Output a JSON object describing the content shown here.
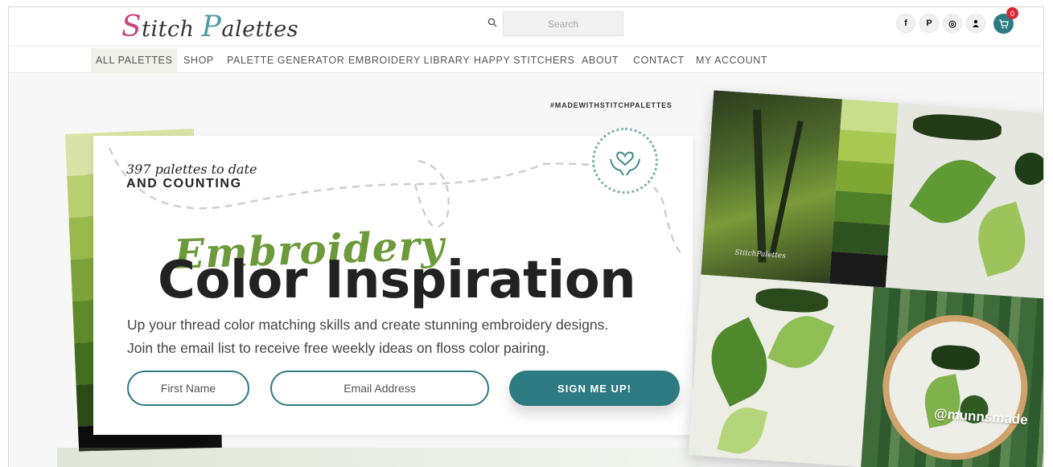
{
  "header": {
    "logo": {
      "cap1": "S",
      "rest1": "titch ",
      "cap2": "P",
      "rest2": "alettes"
    },
    "search": {
      "placeholder": "Search"
    },
    "social_icons": [
      "facebook-icon",
      "pinterest-icon",
      "instagram-icon",
      "account-icon"
    ],
    "social_glyphs": {
      "facebook": "f",
      "pinterest": "P",
      "instagram": "◎",
      "account": "●"
    },
    "cart": {
      "count": "0"
    }
  },
  "nav": {
    "items": [
      "ALL PALETTES",
      "SHOP",
      "PALETTE GENERATOR",
      "EMBROIDERY LIBRARY",
      "HAPPY STITCHERS",
      "ABOUT",
      "CONTACT",
      "MY ACCOUNT"
    ]
  },
  "hero": {
    "hashtag": "#MADEWITHSTITCHPALETTES",
    "tagline_script": "397 palettes to date",
    "tagline_caps": "AND COUNTING",
    "script_title": "Embroidery",
    "main_title": "Color Inspiration",
    "subtitle_line1": "Up your thread color matching skills and create stunning embroidery designs.",
    "subtitle_line2": "Join the email list to receive free weekly ideas on floss color pairing.",
    "first_name_placeholder": "First Name",
    "email_placeholder": "Email Address",
    "signup_label": "SIGN ME UP!",
    "swatch_colors": [
      "#d9e3a6",
      "#b7cf6f",
      "#98b94c",
      "#7ea23a",
      "#5f8a2a",
      "#436d1f",
      "#2c4a14",
      "#0d0d0d"
    ],
    "collage_handle": "@munnsmade",
    "forest_mark": "StitchPalettes",
    "palette_colors": [
      "#c9de8a",
      "#a8c852",
      "#7fa832",
      "#4f7f26",
      "#2e5220",
      "#1a1a1a"
    ],
    "accent": "#2d7a80"
  }
}
